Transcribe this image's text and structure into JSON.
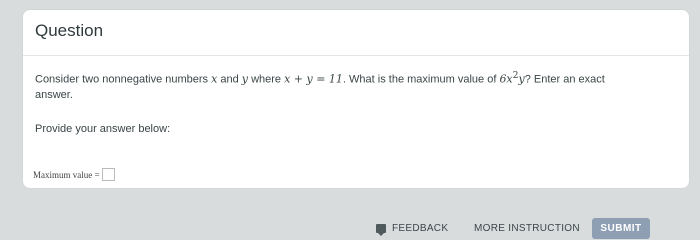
{
  "card": {
    "title": "Question",
    "question_parts": [
      "Consider two nonnegative numbers ",
      "x",
      " and ",
      "y",
      " where ",
      "x + y = 11",
      ". What is the maximum value of ",
      "6x",
      "2",
      "y",
      "? Enter an exact answer."
    ],
    "prompt": "Provide your answer below:",
    "answer_label": "Maximum value ="
  },
  "footer": {
    "feedback_label": "FEEDBACK",
    "more_instruction_label": "MORE INSTRUCTION",
    "submit_label": "SUBMIT"
  },
  "icons": {
    "feedback": "speech-bubble-icon"
  },
  "colors": {
    "submit_bg": "#8e9fb4",
    "text": "#3a4547"
  }
}
